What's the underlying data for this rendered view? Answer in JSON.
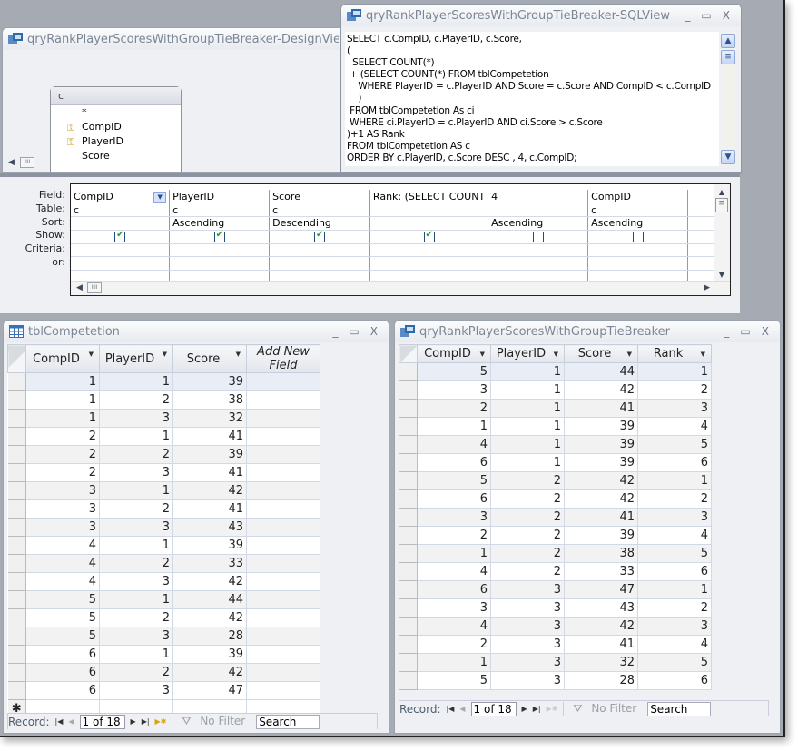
{
  "design_view": {
    "title": "qryRankPlayerScoresWithGroupTieBreaker-DesignView",
    "field_list": {
      "table_alias": "c",
      "fields": [
        {
          "name": "*",
          "key": false
        },
        {
          "name": "CompID",
          "key": true
        },
        {
          "name": "PlayerID",
          "key": true
        },
        {
          "name": "Score",
          "key": false
        }
      ]
    },
    "grid": {
      "row_labels": [
        "Field:",
        "Table:",
        "Sort:",
        "Show:",
        "Criteria:",
        "or:"
      ],
      "columns": [
        {
          "field": "CompID",
          "table": "c",
          "sort": "",
          "show": true
        },
        {
          "field": "PlayerID",
          "table": "c",
          "sort": "Ascending",
          "show": true
        },
        {
          "field": "Score",
          "table": "c",
          "sort": "Descending",
          "show": true
        },
        {
          "field": "Rank: (SELECT COUNT",
          "table": "",
          "sort": "",
          "show": true
        },
        {
          "field": "4",
          "table": "",
          "sort": "Ascending",
          "show": false
        },
        {
          "field": "CompID",
          "table": "c",
          "sort": "Ascending",
          "show": false
        }
      ]
    }
  },
  "sql_view": {
    "title": "qryRankPlayerScoresWithGroupTieBreaker-SQLView",
    "lines": [
      "SELECT c.CompID, c.PlayerID, c.Score,",
      "(",
      "  SELECT COUNT(*)",
      " + (SELECT COUNT(*) FROM tblCompetetion",
      "    WHERE PlayerID = c.PlayerID AND Score = c.Score AND CompID < c.CompID",
      "    )",
      " FROM tblCompetetion As ci",
      " WHERE ci.PlayerID = c.PlayerID AND ci.Score > c.Score",
      ")+1 AS Rank",
      "FROM tblCompetetion AS c",
      "ORDER BY c.PlayerID, c.Score DESC , 4, c.CompID;"
    ]
  },
  "table_window": {
    "title": "tblCompetetion",
    "columns": [
      "CompID",
      "PlayerID",
      "Score",
      "Add New Field"
    ],
    "rows": [
      [
        1,
        1,
        39
      ],
      [
        1,
        2,
        38
      ],
      [
        1,
        3,
        32
      ],
      [
        2,
        1,
        41
      ],
      [
        2,
        2,
        39
      ],
      [
        2,
        3,
        41
      ],
      [
        3,
        1,
        42
      ],
      [
        3,
        2,
        41
      ],
      [
        3,
        3,
        43
      ],
      [
        4,
        1,
        39
      ],
      [
        4,
        2,
        33
      ],
      [
        4,
        3,
        42
      ],
      [
        5,
        1,
        44
      ],
      [
        5,
        2,
        42
      ],
      [
        5,
        3,
        28
      ],
      [
        6,
        1,
        39
      ],
      [
        6,
        2,
        42
      ],
      [
        6,
        3,
        47
      ]
    ],
    "new_row_marker": "✱",
    "nav": {
      "label": "Record:",
      "position": "1 of 18",
      "filter": "No Filter",
      "search": "Search"
    }
  },
  "query_window": {
    "title": "qryRankPlayerScoresWithGroupTieBreaker",
    "columns": [
      "CompID",
      "PlayerID",
      "Score",
      "Rank"
    ],
    "rows": [
      [
        5,
        1,
        44,
        1
      ],
      [
        3,
        1,
        42,
        2
      ],
      [
        2,
        1,
        41,
        3
      ],
      [
        1,
        1,
        39,
        4
      ],
      [
        4,
        1,
        39,
        5
      ],
      [
        6,
        1,
        39,
        6
      ],
      [
        5,
        2,
        42,
        1
      ],
      [
        6,
        2,
        42,
        2
      ],
      [
        3,
        2,
        41,
        3
      ],
      [
        2,
        2,
        39,
        4
      ],
      [
        1,
        2,
        38,
        5
      ],
      [
        4,
        2,
        33,
        6
      ],
      [
        6,
        3,
        47,
        1
      ],
      [
        3,
        3,
        43,
        2
      ],
      [
        4,
        3,
        42,
        3
      ],
      [
        2,
        3,
        41,
        4
      ],
      [
        1,
        3,
        32,
        5
      ],
      [
        5,
        3,
        28,
        6
      ]
    ],
    "nav": {
      "label": "Record:",
      "position": "1 of 18",
      "filter": "No Filter",
      "search": "Search"
    }
  },
  "window_buttons": {
    "minimize": "_",
    "maximize": "▭",
    "close": "X"
  }
}
